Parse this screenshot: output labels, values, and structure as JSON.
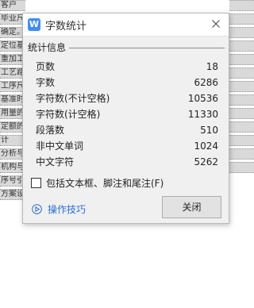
{
  "background": {
    "doc_lines": [
      "客户",
      "毕业尺寸",
      "确定。",
      "定位基",
      "重加工",
      "工艺路",
      "工序尺",
      "基准时",
      "用量的",
      "定额的",
      "计",
      "分析与",
      "机构与",
      "序号引",
      "方案设"
    ]
  },
  "dialog": {
    "title": "字数统计",
    "app_icon_letter": "W",
    "section_title": "统计信息",
    "stats": [
      {
        "label": "页数",
        "value": "18"
      },
      {
        "label": "字数",
        "value": "6286"
      },
      {
        "label": "字符数(不计空格)",
        "value": "10536"
      },
      {
        "label": "字符数(计空格)",
        "value": "11330"
      },
      {
        "label": "段落数",
        "value": "510"
      },
      {
        "label": "非中文单词",
        "value": "1024"
      },
      {
        "label": "中文字符",
        "value": "5262"
      }
    ],
    "checkbox_label": "包括文本框、脚注和尾注(F)",
    "checkbox_checked": false,
    "tips_link_label": "操作技巧",
    "close_button_label": "关闭"
  },
  "colors": {
    "link": "#2b6fd6",
    "app_icon": "#3f8df5",
    "dialog_bg": "#f0f0f0"
  },
  "icons": {
    "app": "wps-writer-icon",
    "close": "close-icon",
    "tips": "play-circle-icon"
  }
}
